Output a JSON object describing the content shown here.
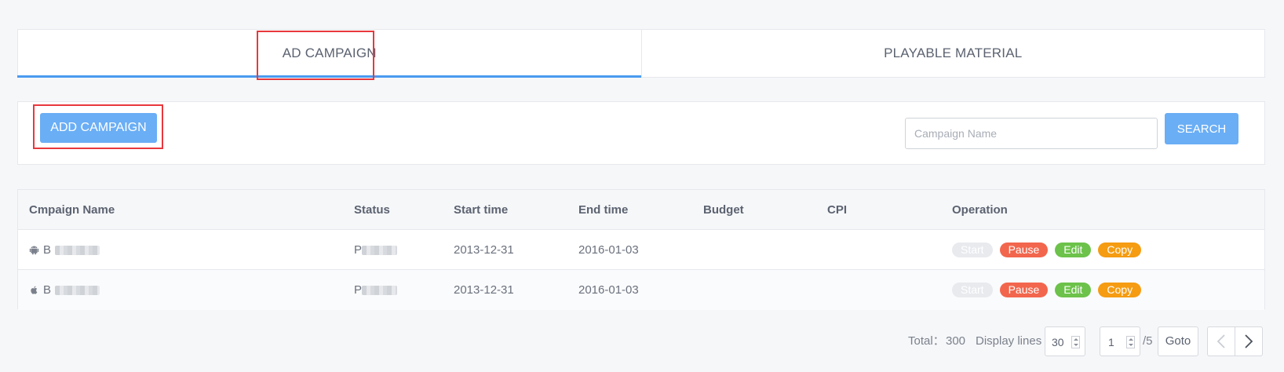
{
  "tabs": [
    {
      "label": "AD CAMPAIGN",
      "active": true
    },
    {
      "label": "PLAYABLE MATERIAL",
      "active": false
    }
  ],
  "toolbar": {
    "add_label": "ADD CAMPAIGN",
    "search_placeholder": "Campaign Name",
    "search_value": "",
    "search_label": "SEARCH"
  },
  "table": {
    "headers": [
      "Cmpaign Name",
      "Status",
      "Start time",
      "End time",
      "Budget",
      "CPI",
      "Operation"
    ],
    "rows": [
      {
        "platform_icon": "android-icon",
        "name": "B",
        "status": "P",
        "start": "2013-12-31",
        "end": "2016-01-03",
        "budget": "",
        "cpi": ""
      },
      {
        "platform_icon": "apple-icon",
        "name": "B",
        "status": "P",
        "start": "2013-12-31",
        "end": "2016-01-03",
        "budget": "",
        "cpi": ""
      }
    ],
    "ops": {
      "start": "Start",
      "pause": "Pause",
      "edit": "Edit",
      "copy": "Copy"
    }
  },
  "pagination": {
    "total_label": "Total：",
    "total": "300",
    "display_label": "Display lines",
    "lines": "30",
    "page": "1",
    "pages": "/5",
    "goto_label": "Goto"
  },
  "colors": {
    "accent": "#4a9af0",
    "primary_button": "#6aaef5",
    "highlight_box": "#e8383d",
    "pause": "#f2664d",
    "edit": "#6cc24a",
    "copy": "#f59c12",
    "start_disabled": "#e8eaee"
  }
}
